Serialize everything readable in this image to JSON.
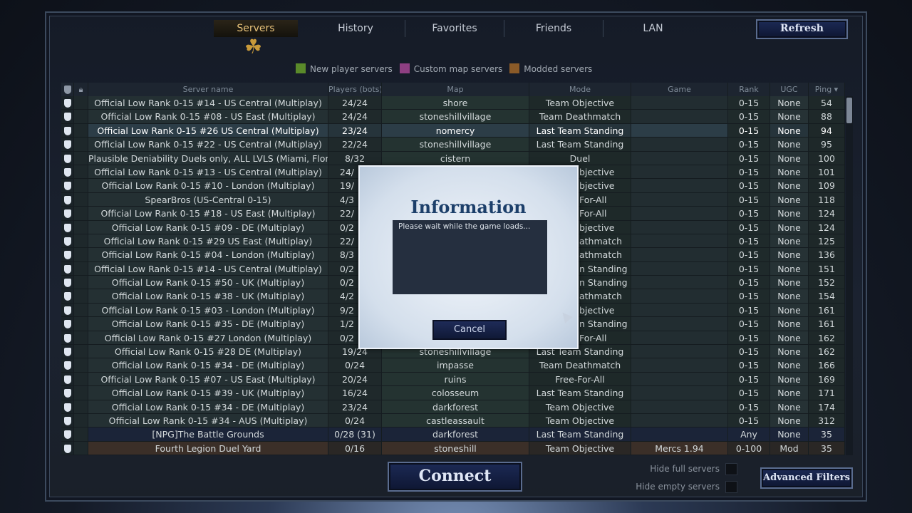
{
  "tabs": [
    {
      "label": "Servers",
      "active": true
    },
    {
      "label": "History"
    },
    {
      "label": "Favorites"
    },
    {
      "label": "Friends"
    },
    {
      "label": "LAN"
    }
  ],
  "refresh_label": "Refresh",
  "legend": [
    {
      "label": "New player servers",
      "color": "#5a8a2a"
    },
    {
      "label": "Custom map servers",
      "color": "#8e3f82"
    },
    {
      "label": "Modded servers",
      "color": "#8a5a28"
    }
  ],
  "columns": [
    "",
    "",
    "Server name",
    "Players (bots)",
    "Map",
    "Mode",
    "Game",
    "Rank",
    "UGC",
    "Ping ▾"
  ],
  "sort_column": "Ping",
  "selected_row": 2,
  "rows": [
    [
      "Official Low Rank 0-15 #14 - US Central (Multiplay)",
      "24/24",
      "shore",
      "Team Objective",
      "",
      "0-15",
      "None",
      "54"
    ],
    [
      "Official Low Rank 0-15 #08 - US East (Multiplay)",
      "24/24",
      "stoneshillvillage",
      "Team Deathmatch",
      "",
      "0-15",
      "None",
      "88"
    ],
    [
      "Official Low Rank 0-15 #26 US Central (Multiplay)",
      "23/24",
      "nomercy",
      "Last Team Standing",
      "",
      "0-15",
      "None",
      "94"
    ],
    [
      "Official Low Rank 0-15 #22 - US Central (Multiplay)",
      "22/24",
      "stoneshillvillage",
      "Last Team Standing",
      "",
      "0-15",
      "None",
      "95"
    ],
    [
      "Plausible Deniability Duels only, ALL LVLS (Miami, Floric",
      "8/32",
      "cistern",
      "Duel",
      "",
      "0-15",
      "None",
      "100"
    ],
    [
      "Official Low Rank 0-15 #13 - US Central (Multiplay)",
      "24/",
      "",
      "bjective",
      "",
      "0-15",
      "None",
      "101"
    ],
    [
      "Official Low Rank 0-15 #10 - London (Multiplay)",
      "19/",
      "",
      "bjective",
      "",
      "0-15",
      "None",
      "109"
    ],
    [
      "SpearBros (US-Central 0-15)",
      "4/3",
      "",
      "For-All",
      "",
      "0-15",
      "None",
      "118"
    ],
    [
      "Official Low Rank 0-15 #18 - US East (Multiplay)",
      "22/",
      "",
      "For-All",
      "",
      "0-15",
      "None",
      "124"
    ],
    [
      "Official Low Rank 0-15 #09 - DE (Multiplay)",
      "0/2",
      "",
      "bjective",
      "",
      "0-15",
      "None",
      "124"
    ],
    [
      "Official Low Rank 0-15 #29 US East (Multiplay)",
      "22/",
      "",
      "athmatch",
      "",
      "0-15",
      "None",
      "125"
    ],
    [
      "Official Low Rank 0-15 #04 - London (Multiplay)",
      "8/3",
      "",
      "athmatch",
      "",
      "0-15",
      "None",
      "136"
    ],
    [
      "Official Low Rank 0-15 #14 - US Central (Multiplay)",
      "0/2",
      "",
      "n Standing",
      "",
      "0-15",
      "None",
      "151"
    ],
    [
      "Official Low Rank 0-15 #50 - UK (Multiplay)",
      "0/2",
      "",
      "n Standing",
      "",
      "0-15",
      "None",
      "152"
    ],
    [
      "Official Low Rank 0-15 #38 - UK (Multiplay)",
      "4/2",
      "",
      "athmatch",
      "",
      "0-15",
      "None",
      "154"
    ],
    [
      "Official Low Rank 0-15 #03 - London (Multiplay)",
      "9/2",
      "",
      "bjective",
      "",
      "0-15",
      "None",
      "161"
    ],
    [
      "Official Low Rank 0-15 #35 - DE (Multiplay)",
      "1/2",
      "",
      "n Standing",
      "",
      "0-15",
      "None",
      "161"
    ],
    [
      "Official Low Rank 0-15 #27 London (Multiplay)",
      "0/2",
      "",
      "For-All",
      "",
      "0-15",
      "None",
      "162"
    ],
    [
      "Official Low Rank 0-15 #28 DE (Multiplay)",
      "19/24",
      "stoneshillvillage",
      "Last Team Standing",
      "",
      "0-15",
      "None",
      "162"
    ],
    [
      "Official Low Rank 0-15 #34 - DE (Multiplay)",
      "0/24",
      "impasse",
      "Team Deathmatch",
      "",
      "0-15",
      "None",
      "166"
    ],
    [
      "Official Low Rank 0-15 #07 - US East (Multiplay)",
      "20/24",
      "ruins",
      "Free-For-All",
      "",
      "0-15",
      "None",
      "169"
    ],
    [
      "Official Low Rank 0-15 #39 - UK (Multiplay)",
      "16/24",
      "colosseum",
      "Last Team Standing",
      "",
      "0-15",
      "None",
      "171"
    ],
    [
      "Official Low Rank 0-15 #34 - DE (Multiplay)",
      "23/24",
      "darkforest",
      "Team Objective",
      "",
      "0-15",
      "None",
      "174"
    ],
    [
      "Official Low Rank 0-15 #34 - AUS (Multiplay)",
      "0/24",
      "castleassault",
      "Team Objective",
      "",
      "0-15",
      "None",
      "312"
    ],
    [
      "[NPG]The Battle Grounds",
      "0/28 (31)",
      "darkforest",
      "Last Team Standing",
      "",
      "Any",
      "None",
      "35"
    ],
    [
      "Fourth Legion Duel Yard",
      "0/16",
      "stoneshill",
      "Team Objective",
      "Mercs 1.94",
      "0-100",
      "Mod",
      "35"
    ]
  ],
  "dialog": {
    "title": "Information",
    "message": "Please wait while the game loads...",
    "cancel_label": "Cancel"
  },
  "connect_label": "Connect",
  "hide_full_label": "Hide full servers",
  "hide_full_checked": false,
  "hide_empty_label": "Hide empty servers",
  "hide_empty_checked": false,
  "advanced_filters_label": "Advanced Filters"
}
